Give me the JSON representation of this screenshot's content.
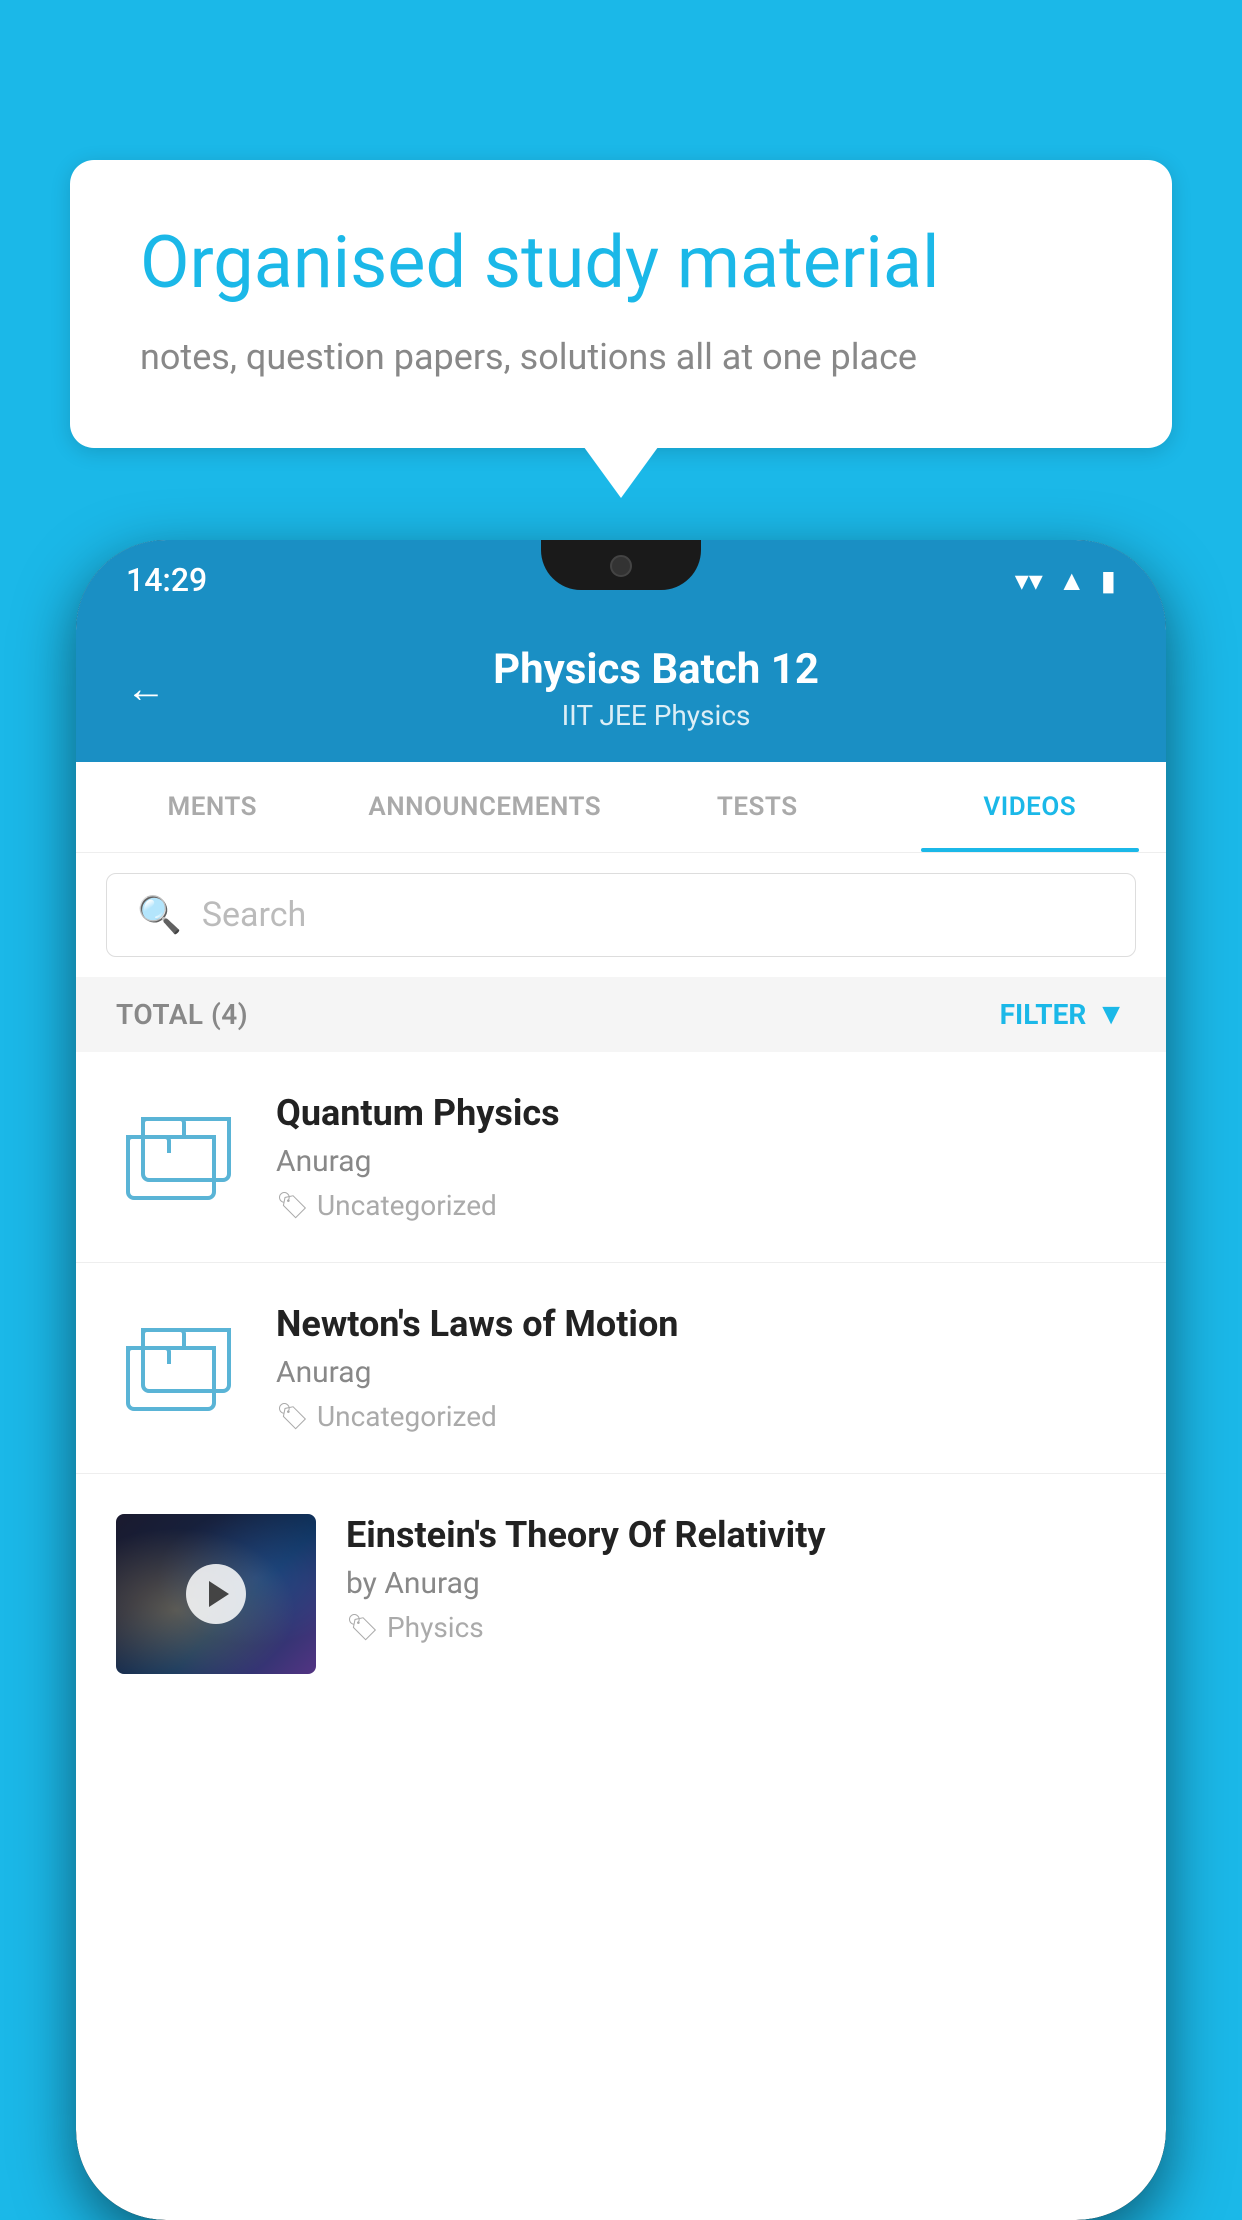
{
  "background": {
    "color": "#1BB8E8"
  },
  "bubble": {
    "title": "Organised study material",
    "subtitle": "notes, question papers, solutions all at one place"
  },
  "phone": {
    "status_time": "14:29",
    "header": {
      "back_label": "←",
      "title": "Physics Batch 12",
      "subtitle_tags": "IIT JEE   Physics"
    },
    "tabs": [
      {
        "label": "MENTS",
        "active": false
      },
      {
        "label": "ANNOUNCEMENTS",
        "active": false
      },
      {
        "label": "TESTS",
        "active": false
      },
      {
        "label": "VIDEOS",
        "active": true
      }
    ],
    "search": {
      "placeholder": "Search"
    },
    "filter_bar": {
      "total_label": "TOTAL (4)",
      "filter_label": "FILTER"
    },
    "videos": [
      {
        "title": "Quantum Physics",
        "author": "Anurag",
        "tag": "Uncategorized",
        "has_thumb": false
      },
      {
        "title": "Newton's Laws of Motion",
        "author": "Anurag",
        "tag": "Uncategorized",
        "has_thumb": false
      },
      {
        "title": "Einstein's Theory Of Relativity",
        "author": "by Anurag",
        "tag": "Physics",
        "has_thumb": true
      }
    ]
  }
}
